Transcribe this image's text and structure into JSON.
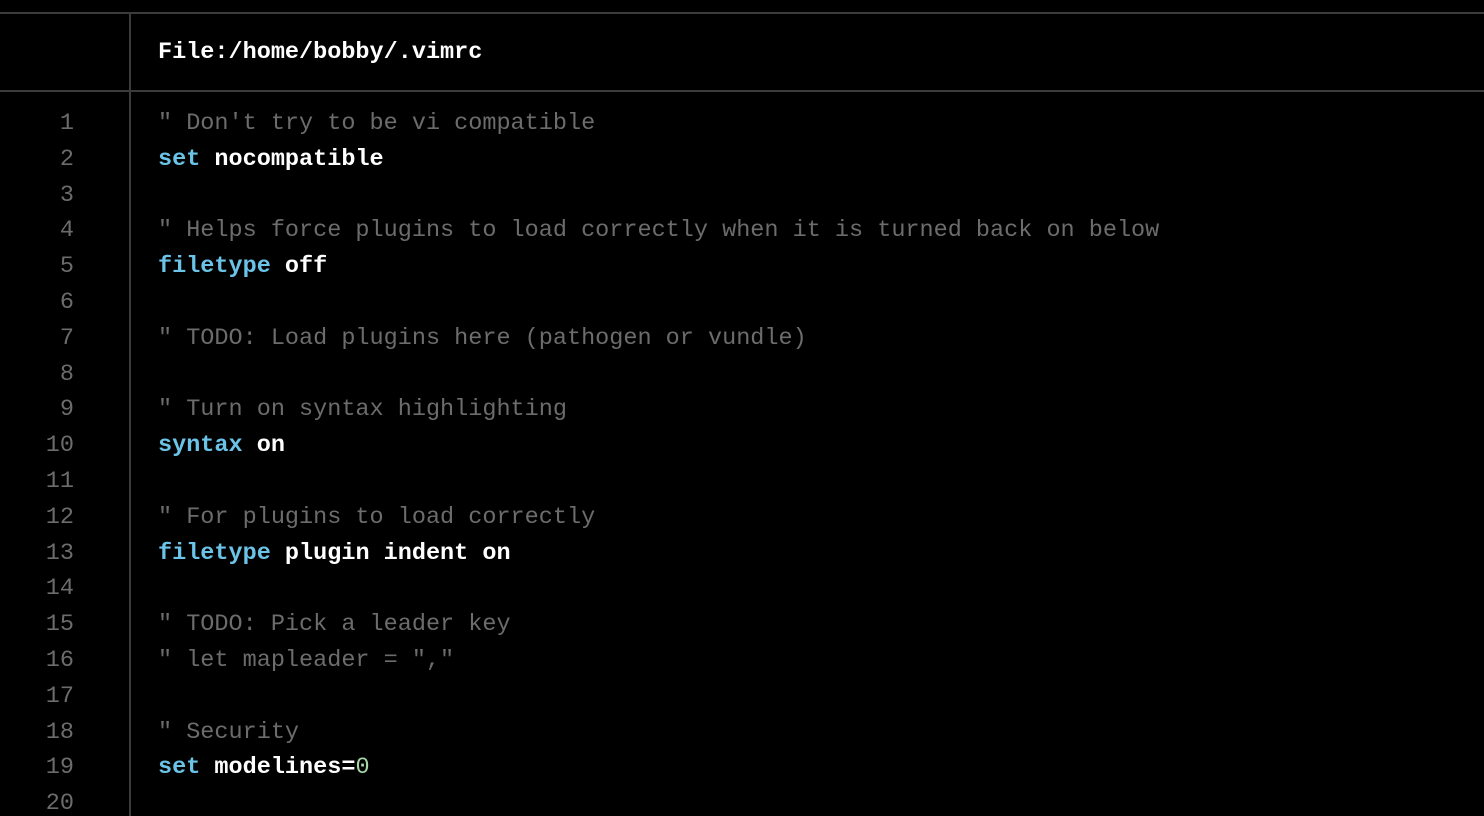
{
  "header": {
    "label": "File: ",
    "path": "/home/bobby/.vimrc"
  },
  "lineNumbers": [
    "1",
    "2",
    "3",
    "4",
    "5",
    "6",
    "7",
    "8",
    "9",
    "10",
    "11",
    "12",
    "13",
    "14",
    "15",
    "16",
    "17",
    "18",
    "19",
    "20"
  ],
  "lines": [
    {
      "segments": [
        {
          "cls": "c",
          "t": "\" Don't try to be vi compatible"
        }
      ]
    },
    {
      "segments": [
        {
          "cls": "k",
          "t": "set"
        },
        {
          "cls": "w",
          "t": " nocompatible"
        }
      ]
    },
    {
      "segments": []
    },
    {
      "segments": [
        {
          "cls": "c",
          "t": "\" Helps force plugins to load correctly when it is turned back on below"
        }
      ]
    },
    {
      "segments": [
        {
          "cls": "k",
          "t": "filetype"
        },
        {
          "cls": "w",
          "t": " off"
        }
      ]
    },
    {
      "segments": []
    },
    {
      "segments": [
        {
          "cls": "c",
          "t": "\" TODO: Load plugins here (pathogen or vundle)"
        }
      ]
    },
    {
      "segments": []
    },
    {
      "segments": [
        {
          "cls": "c",
          "t": "\" Turn on syntax highlighting"
        }
      ]
    },
    {
      "segments": [
        {
          "cls": "k",
          "t": "syntax"
        },
        {
          "cls": "w",
          "t": " on"
        }
      ]
    },
    {
      "segments": []
    },
    {
      "segments": [
        {
          "cls": "c",
          "t": "\" For plugins to load correctly"
        }
      ]
    },
    {
      "segments": [
        {
          "cls": "k",
          "t": "filetype"
        },
        {
          "cls": "w",
          "t": " plugin indent on"
        }
      ]
    },
    {
      "segments": []
    },
    {
      "segments": [
        {
          "cls": "c",
          "t": "\" TODO: Pick a leader key"
        }
      ]
    },
    {
      "segments": [
        {
          "cls": "c",
          "t": "\" let mapleader = \",\""
        }
      ]
    },
    {
      "segments": []
    },
    {
      "segments": [
        {
          "cls": "c",
          "t": "\" Security"
        }
      ]
    },
    {
      "segments": [
        {
          "cls": "k",
          "t": "set"
        },
        {
          "cls": "w",
          "t": " modelines="
        },
        {
          "cls": "n",
          "t": "0"
        }
      ]
    },
    {
      "segments": []
    }
  ]
}
